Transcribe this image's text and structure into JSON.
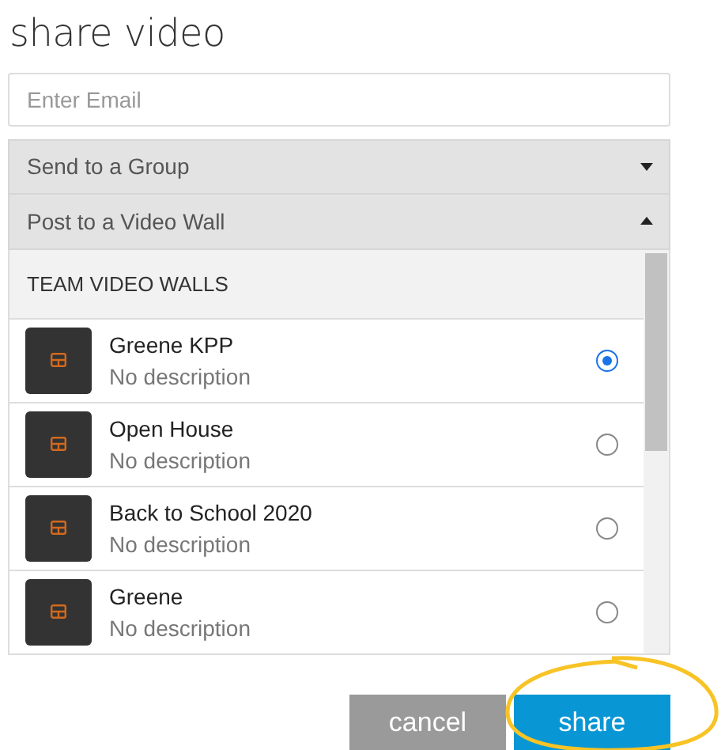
{
  "title": "share video",
  "email": {
    "placeholder": "Enter Email"
  },
  "sections": [
    {
      "label": "Send to a Group",
      "expanded": false
    },
    {
      "label": "Post to a Video Wall",
      "expanded": true
    }
  ],
  "list": {
    "header": "TEAM VIDEO WALLS",
    "items": [
      {
        "name": "Greene KPP",
        "description": "No description",
        "selected": true
      },
      {
        "name": "Open House",
        "description": "No description",
        "selected": false
      },
      {
        "name": "Back to School 2020",
        "description": "No description",
        "selected": false
      },
      {
        "name": "Greene",
        "description": "No description",
        "selected": false
      }
    ]
  },
  "buttons": [
    {
      "label": "cancel",
      "kind": "secondary"
    },
    {
      "label": "share",
      "kind": "primary"
    }
  ]
}
